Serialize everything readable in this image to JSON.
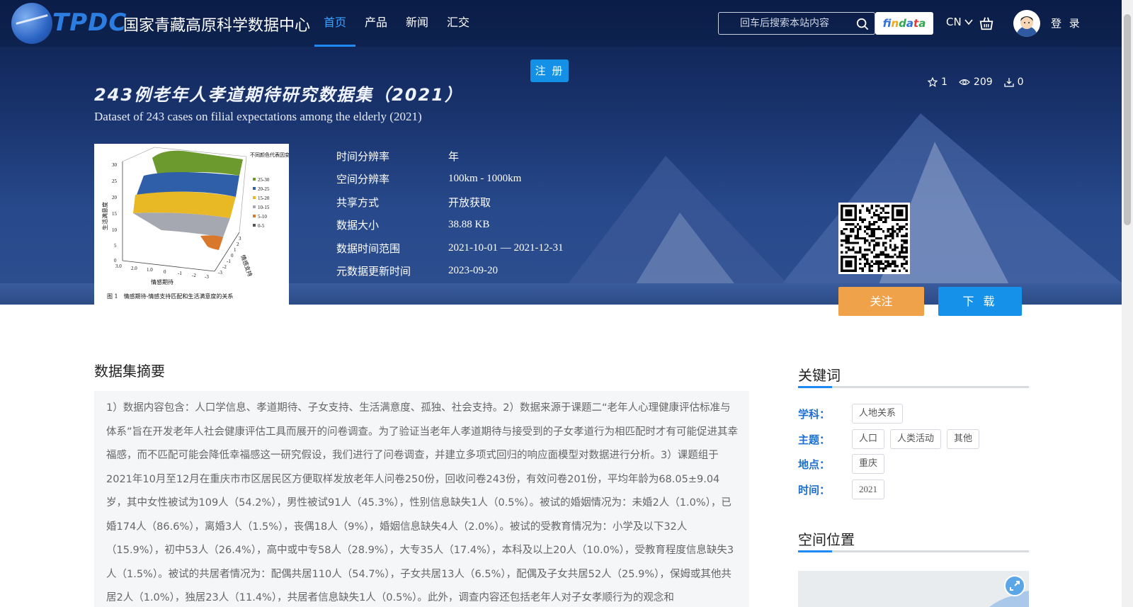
{
  "brand": {
    "logo_text": "TPDC",
    "site_name": "国家青藏高原科学数据中心"
  },
  "nav": {
    "items": [
      "首页",
      "产品",
      "新闻",
      "汇交"
    ]
  },
  "search": {
    "placeholder": "回车后搜索本站内容"
  },
  "findata_letters": [
    "f",
    "i",
    "n",
    "d",
    "a",
    "t",
    "a"
  ],
  "language": "CN",
  "login_label": "登 录",
  "register_label": "注 册",
  "dataset": {
    "title_zh": "243例老年人孝道期待研究数据集（2021）",
    "title_en": "Dataset of 243 cases on filial expectations among the elderly (2021)",
    "stars": "1",
    "views": "209",
    "downloads": "0"
  },
  "meta": [
    {
      "label": "时间分辨率",
      "value": "年"
    },
    {
      "label": "空间分辨率",
      "value": "100km - 1000km"
    },
    {
      "label": "共享方式",
      "value": "开放获取"
    },
    {
      "label": "数据大小",
      "value": "38.88 KB"
    },
    {
      "label": "数据时间范围",
      "value": "2021-10-01 — 2021-12-31"
    },
    {
      "label": "元数据更新时间",
      "value": "2023-09-20"
    }
  ],
  "thumbnail": {
    "legend_title": "不同颜色代表因变量范围",
    "legend": [
      "25-30",
      "20-25",
      "15-20",
      "10-15",
      "5-10",
      "0-5"
    ],
    "ylabel": "生活满意度",
    "xlabel": "情感期待",
    "zlabel": "情感支持",
    "caption": "图 1　情感期待-情感支持匹配和生活满意度的关系",
    "yticks": [
      "30",
      "25",
      "20",
      "15",
      "10",
      "5",
      "0"
    ],
    "xticks": [
      "3.0",
      "2.0",
      "1.0",
      "0",
      "-1",
      "-2",
      "-3"
    ],
    "zticks": [
      "3",
      "2",
      "1",
      "0",
      "-1",
      "-2",
      "-3"
    ]
  },
  "actions": {
    "follow": "关注",
    "download": "下 载"
  },
  "abstract": {
    "title": "数据集摘要",
    "text": "1）数据内容包含：人口学信息、孝道期待、子女支持、生活满意度、孤独、社会支持。2）数据来源于课题二“老年人心理健康评估标准与体系”旨在开发老年人社会健康评估工具而展开的问卷调查。为了验证当老年人孝道期待与接受到的子女孝道行为相匹配时才有可能促进其幸福感，而不匹配可能会降低幸福感这一研究假设，我们进行了问卷调查，并建立多项式回归的响应面模型对数据进行分析。3）课题组于2021年10月至12月在重庆市市区居民区方便取样发放老年人问卷250份，回收问卷243份，有效问卷201份，平均年龄为68.05±9.04岁，其中女性被试为109人（54.2%），男性被试91人（45.3%），性别信息缺失1人（0.5%）。被试的婚姻情况为：未婚2人（1.0%），已婚174人（86.6%），离婚3人（1.5%），丧偶18人（9%），婚姻信息缺失4人（2.0%）。被试的受教育情况为：小学及以下32人（15.9%），初中53人（26.4%），高中或中专58人（28.9%），大专35人（17.4%），本科及以上20人（10.0%），受教育程度信息缺失3人（1.5%）。被试的共居者情况为：配偶共居110人（54.7%），子女共居13人（6.5%），配偶及子女共居52人（25.9%），保姆或其他共居2人（1.0%），独居23人（11.4%），共居者信息缺失1人（0.5%）。此外，调查内容还包括老年人对子女孝顺行为的观念和"
  },
  "keywords": {
    "title": "关键词",
    "rows": [
      {
        "label": "学科：",
        "tags": [
          "人地关系"
        ]
      },
      {
        "label": "主题：",
        "tags": [
          "人口",
          "人类活动",
          "其他"
        ]
      },
      {
        "label": "地点：",
        "tags": [
          "重庆"
        ]
      },
      {
        "label": "时间：",
        "tags": [
          "2021"
        ]
      }
    ]
  },
  "location": {
    "title": "空间位置"
  }
}
